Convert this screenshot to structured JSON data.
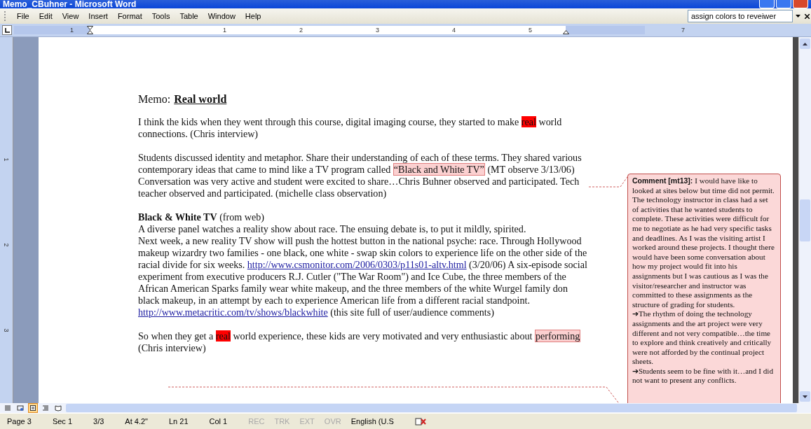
{
  "window": {
    "title": "Memo_CBuhner - Microsoft Word"
  },
  "menu": [
    "File",
    "Edit",
    "View",
    "Insert",
    "Format",
    "Tools",
    "Table",
    "Window",
    "Help"
  ],
  "help_box": {
    "value": "assign colors to reveiwer"
  },
  "ruler": {
    "labels": [
      "1",
      "1",
      "2",
      "3",
      "4",
      "5",
      "7"
    ],
    "vertical_labels": [
      "1",
      "2",
      "3"
    ]
  },
  "document": {
    "label": "Memo:",
    "heading": "Real world",
    "paragraphs": [
      {
        "kind": "body",
        "runs": [
          {
            "kind": "plain",
            "text": "I think the kids when they went through this course, digital imaging course, they started to make "
          },
          {
            "kind": "highlight",
            "text": "real"
          },
          {
            "kind": "plain",
            "text": " world connections. (Chris interview)"
          }
        ]
      },
      {
        "kind": "body",
        "runs": [
          {
            "kind": "plain",
            "text": "Students discussed identity and metaphor. Share their understanding of each of these terms. They shared various contemporary ideas that came to mind like a TV program called "
          },
          {
            "kind": "comment",
            "text": "“Black and White TV”"
          },
          {
            "kind": "plain",
            "text": " (MT observe 3/13/06) Conversation was very active and student were excited to share…Chris Buhner observed and participated. Tech teacher observed and participated. (michelle class observation)"
          }
        ]
      },
      {
        "kind": "body",
        "runs": [
          {
            "kind": "bold",
            "text": "Black & White TV"
          },
          {
            "kind": "plain",
            "text": " (from web)"
          },
          {
            "kind": "break"
          },
          {
            "kind": "plain",
            "text": "A diverse panel watches a reality show about race. The ensuing debate is, to put it mildly, spirited."
          },
          {
            "kind": "break"
          },
          {
            "kind": "plain",
            "text": "Next week, a new reality TV show will push the hottest button in the national psyche: race. Through Hollywood makeup wizardry two families - one black, one white - swap skin colors to experience life on the other side of the racial divide for six weeks. "
          },
          {
            "kind": "link",
            "text": "http://www.csmonitor.com/2006/0303/p11s01-altv.html"
          },
          {
            "kind": "plain",
            "text": " (3/20/06) A six-episode social experiment from executive producers R.J. Cutler (\"The War Room\") and Ice Cube, the three members of the African American Sparks family wear white makeup, and the three members of the white Wurgel family don black makeup, in an attempt by each to experience American life from a different racial standpoint. "
          },
          {
            "kind": "link",
            "text": "http://www.metacritic.com/tv/shows/blackwhite"
          },
          {
            "kind": "plain",
            "text": "  (this site full of user/audience comments)"
          }
        ]
      },
      {
        "kind": "body",
        "runs": [
          {
            "kind": "plain",
            "text": "So when they get a "
          },
          {
            "kind": "highlight",
            "text": "real"
          },
          {
            "kind": "plain",
            "text": " world experience, these kids are very motivated and very enthusiastic about "
          },
          {
            "kind": "comment",
            "text": "performing"
          },
          {
            "kind": "plain",
            "text": " (Chris interview)"
          }
        ]
      }
    ]
  },
  "comment": {
    "label": "Comment [mt13]:",
    "paragraphs": [
      "I would have like to looked at sites below but time did not permit. The technology instructor in class had a set of activities that he wanted students to complete. These activities were difficult for me to negotiate as he had very specific tasks and deadlines. As I was the visiting artist I worked around these projects. I thought there would have been some conversation about how my project would fit into his assignments but I was cautious as I was the visitor/researcher and instructor was committed to these assignments as the structure of grading for students.",
      "➔The rhythm of doing the technology assignments and the art project were very different and not very compatible…the time to explore and think creatively and critically were not afforded by the continual project sheets.",
      "➔Students seem to be fine with it…and I did not want to present any conflicts."
    ]
  },
  "views": [
    {
      "kind": "normal",
      "selected": false
    },
    {
      "kind": "web",
      "selected": false
    },
    {
      "kind": "print",
      "selected": true
    },
    {
      "kind": "outline",
      "selected": false
    },
    {
      "kind": "reading",
      "selected": false
    }
  ],
  "status_bar": [
    {
      "text": "Page 3",
      "disabled": false
    },
    {
      "text": "Sec 1",
      "disabled": false
    },
    {
      "text": "3/3",
      "disabled": false
    },
    {
      "text": "At 4.2\"",
      "disabled": false
    },
    {
      "text": "Ln 21",
      "disabled": false
    },
    {
      "text": "Col 1",
      "disabled": false
    },
    {
      "text": "REC",
      "disabled": true
    },
    {
      "text": "TRK",
      "disabled": true
    },
    {
      "text": "EXT",
      "disabled": true
    },
    {
      "text": "OVR",
      "disabled": true
    },
    {
      "text": "English (U.S",
      "disabled": false
    }
  ]
}
